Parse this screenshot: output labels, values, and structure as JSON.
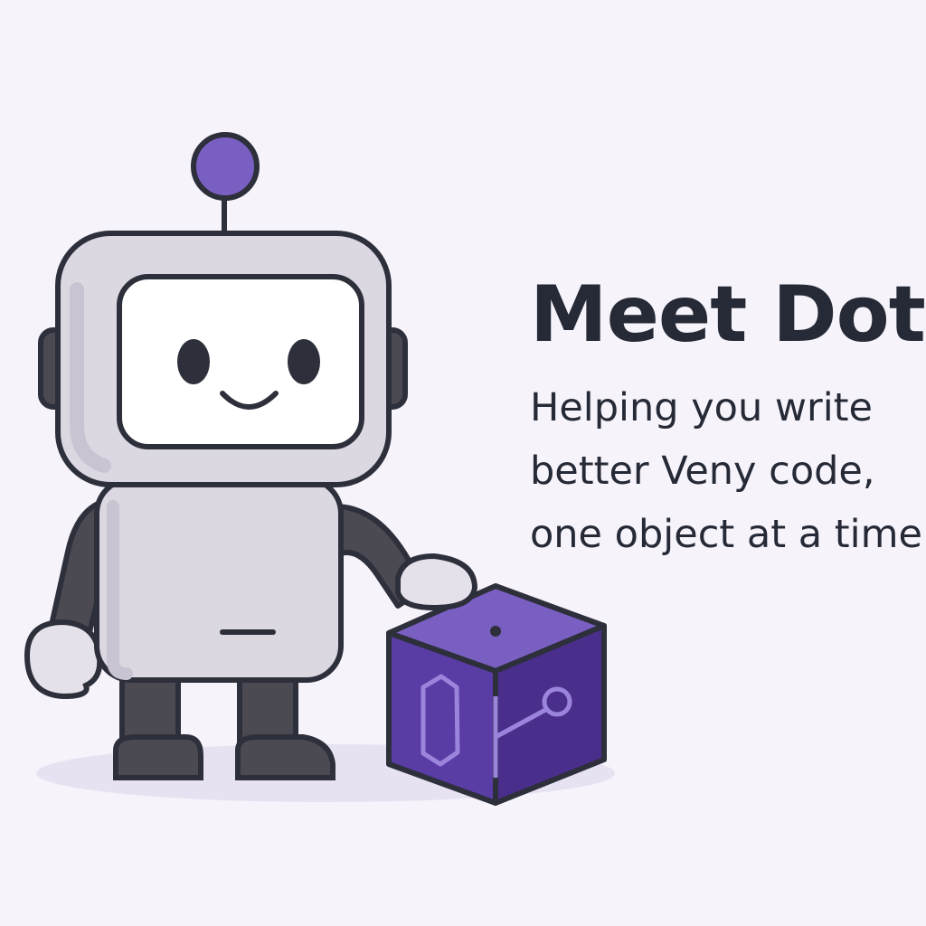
{
  "hero": {
    "headline": "Meet Dot",
    "tagline_lines": [
      "Helping you write",
      "better Veny code,",
      "one object at a time"
    ]
  },
  "illustration": {
    "robot": "friendly robot mascot",
    "cube": "purple object cube with linked-node symbol"
  },
  "colors": {
    "background": "#f6f3fb",
    "text": "#252a36",
    "robot_body": "#dcd8e2",
    "robot_limbs": "#4b4a53",
    "accent_purple": "#7a5fc3",
    "cube_face": "#57389a",
    "outline": "#2d2f3a"
  }
}
